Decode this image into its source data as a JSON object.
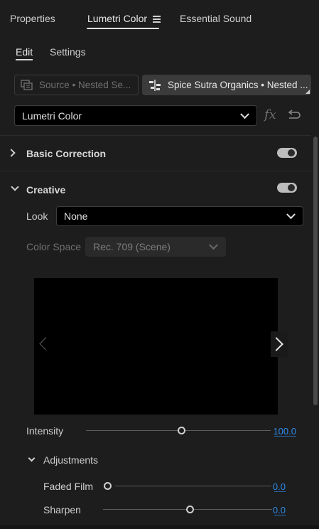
{
  "panel_tabs": [
    {
      "label": "Properties",
      "active": false
    },
    {
      "label": "Lumetri Color",
      "active": true
    },
    {
      "label": "Essential Sound",
      "active": false
    }
  ],
  "sub_tabs": [
    {
      "label": "Edit",
      "active": true
    },
    {
      "label": "Settings",
      "active": false
    }
  ],
  "clips": {
    "source_label": "Source • Nested Se...",
    "sequence_label": "Spice Sutra Organics • Nested ..."
  },
  "effect_select": {
    "value": "Lumetri Color"
  },
  "sections": {
    "basic_correction": {
      "label": "Basic Correction",
      "expanded": false,
      "enabled": true
    },
    "creative": {
      "label": "Creative",
      "expanded": true,
      "enabled": true
    }
  },
  "creative": {
    "look_label": "Look",
    "look_value": "None",
    "color_space_label": "Color Space",
    "color_space_value": "Rec. 709 (Scene)",
    "intensity_label": "Intensity",
    "intensity_value": "100.0",
    "intensity_fraction": 0.5
  },
  "adjustments": {
    "label": "Adjustments",
    "faded_film_label": "Faded Film",
    "faded_film_value": "0.0",
    "faded_film_fraction": 0.0,
    "sharpen_label": "Sharpen",
    "sharpen_value": "0.0",
    "sharpen_fraction": 0.5
  },
  "colors": {
    "background": "#1d1d1d",
    "value_blue": "#2d8ceb",
    "toggle_on": "#bdbdbd"
  }
}
